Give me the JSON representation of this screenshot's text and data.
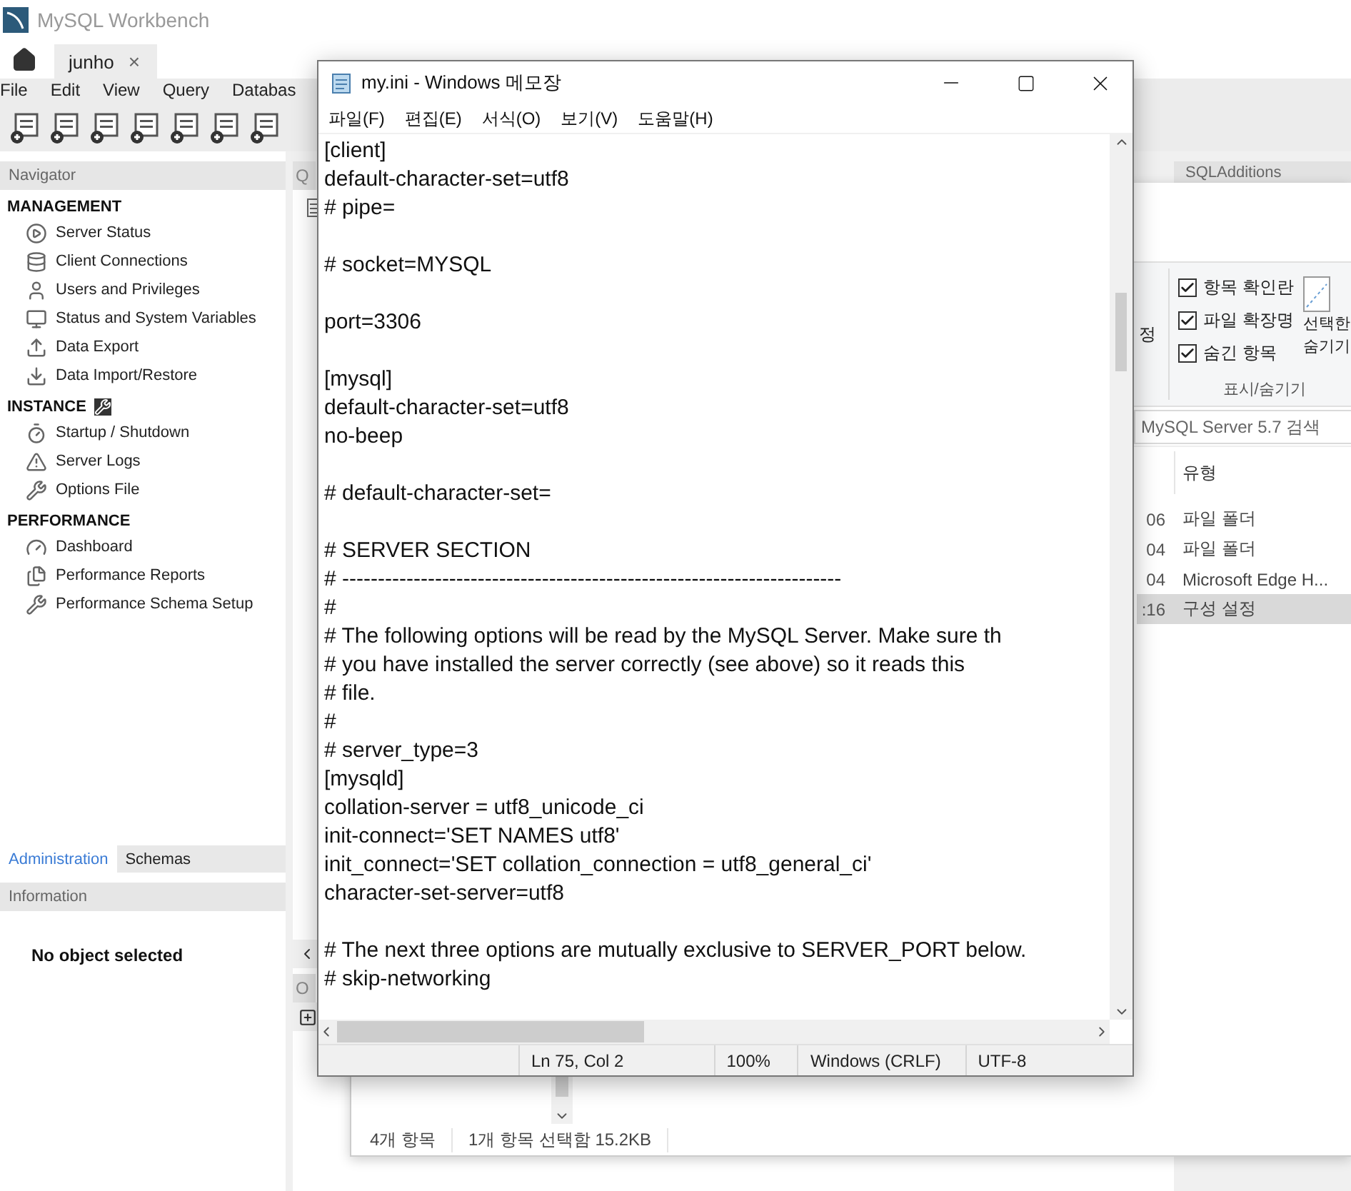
{
  "workbench": {
    "title": "MySQL Workbench",
    "tabs": [
      {
        "label": "junho",
        "selected": true,
        "close": "×"
      }
    ],
    "menu": [
      "File",
      "Edit",
      "View",
      "Query",
      "Databas"
    ],
    "navigator": {
      "title": "Navigator",
      "sections": [
        {
          "title": "MANAGEMENT",
          "items": [
            "Server Status",
            "Client Connections",
            "Users and Privileges",
            "Status and System Variables",
            "Data Export",
            "Data Import/Restore"
          ]
        },
        {
          "title": "INSTANCE",
          "items": [
            "Startup / Shutdown",
            "Server Logs",
            "Options File"
          ]
        },
        {
          "title": "PERFORMANCE",
          "items": [
            "Dashboard",
            "Performance Reports",
            "Performance Schema Setup"
          ]
        }
      ]
    },
    "sidebar_tabs": [
      {
        "label": "Administration",
        "selected": true
      },
      {
        "label": "Schemas",
        "selected": false
      }
    ],
    "information": {
      "title": "Information",
      "message": "No object selected"
    },
    "center_tabs": [
      "Q",
      "O"
    ],
    "right_panel": {
      "title": "SQLAdditions"
    }
  },
  "explorer": {
    "ribbon_fragment": "정",
    "view_options": [
      {
        "label": "항목 확인란",
        "checked": true
      },
      {
        "label": "파일 확장명",
        "checked": true
      },
      {
        "label": "숨긴 항목",
        "checked": true
      }
    ],
    "hide_selected": "선택한 숨기기",
    "group_label": "표시/숨기기",
    "search": {
      "placeholder": "MySQL Server 5.7 검색"
    },
    "columns": [
      "유형"
    ],
    "rows": [
      {
        "date": "06",
        "type": "파일 폴더",
        "selected": false
      },
      {
        "date": "04",
        "type": "파일 폴더",
        "selected": false
      },
      {
        "date": "04",
        "type": "Microsoft Edge H...",
        "selected": false
      },
      {
        "date": ":16",
        "type": "구성 설정",
        "selected": true
      }
    ],
    "status": [
      "4개 항목",
      "1개 항목 선택함 15.2KB"
    ]
  },
  "notepad": {
    "title": "my.ini - Windows 메모장",
    "menu": [
      "파일(F)",
      "편집(E)",
      "서식(O)",
      "보기(V)",
      "도움말(H)"
    ],
    "blocks": [
      [
        "[client]",
        "default-character-set=utf8",
        "# pipe="
      ],
      [
        "# socket=MYSQL"
      ],
      [
        "port=3306"
      ],
      [
        "[mysql]",
        "default-character-set=utf8",
        "no-beep"
      ],
      [
        "# default-character-set="
      ],
      [
        "# SERVER SECTION",
        "# ----------------------------------------------------------------------",
        "#",
        "# The following options will be read by the MySQL Server. Make sure th",
        "# you have installed the server correctly (see above) so it reads this",
        "# file.",
        "#",
        "# server_type=3",
        "[mysqld]",
        "collation-server = utf8_unicode_ci",
        "init-connect='SET NAMES utf8'",
        "init_connect='SET collation_connection = utf8_general_ci'",
        "character-set-server=utf8"
      ],
      [
        "# The next three options are mutually exclusive to SERVER_PORT below.",
        "# skip-networking"
      ]
    ],
    "status": [
      "Ln 75, Col 2",
      "100%",
      "Windows (CRLF)",
      "UTF-8"
    ]
  }
}
